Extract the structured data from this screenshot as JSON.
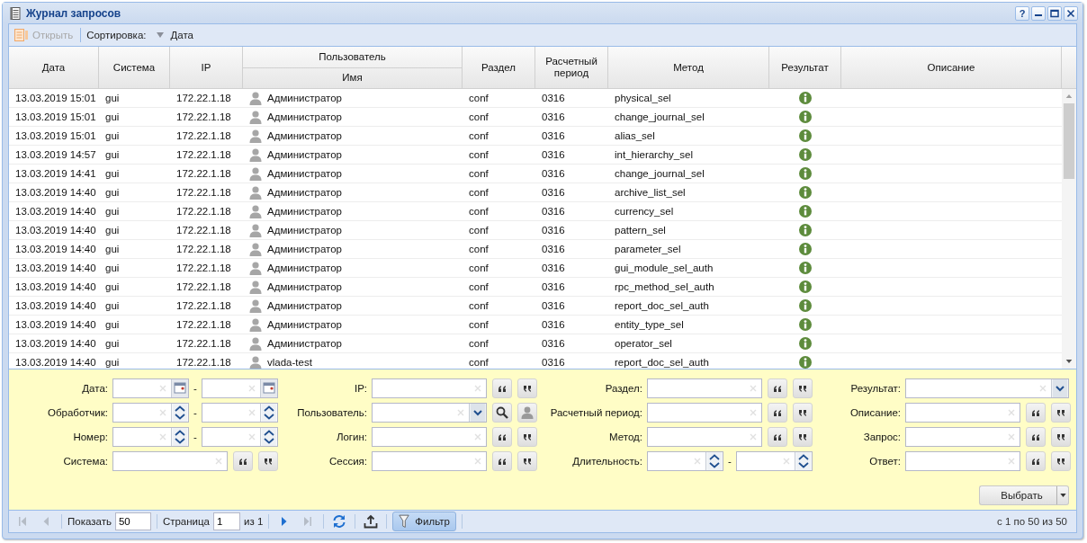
{
  "window": {
    "title": "Журнал запросов",
    "help": "?"
  },
  "toolbar": {
    "open": {
      "label": "Открыть",
      "disabled": true
    },
    "sort_label": "Сортировка:",
    "sort_field": "Дата"
  },
  "table": {
    "columns": [
      {
        "label": "Дата"
      },
      {
        "label": "Система"
      },
      {
        "label": "IP"
      },
      {
        "label": "Пользователь",
        "sub": "Имя"
      },
      {
        "label": "Раздел"
      },
      {
        "label": "Расчетный период"
      },
      {
        "label": "Метод"
      },
      {
        "label": "Результат"
      },
      {
        "label": "Описание"
      }
    ],
    "rows": [
      {
        "date": "13.03.2019 15:01",
        "system": "gui",
        "ip": "172.22.1.18",
        "user": "Администратор",
        "section": "conf",
        "period": "0316",
        "method": "physical_sel",
        "kind": "info"
      },
      {
        "date": "13.03.2019 15:01",
        "system": "gui",
        "ip": "172.22.1.18",
        "user": "Администратор",
        "section": "conf",
        "period": "0316",
        "method": "change_journal_sel",
        "kind": "info"
      },
      {
        "date": "13.03.2019 15:01",
        "system": "gui",
        "ip": "172.22.1.18",
        "user": "Администратор",
        "section": "conf",
        "period": "0316",
        "method": "alias_sel",
        "kind": "info"
      },
      {
        "date": "13.03.2019 14:57",
        "system": "gui",
        "ip": "172.22.1.18",
        "user": "Администратор",
        "section": "conf",
        "period": "0316",
        "method": "int_hierarchy_sel",
        "kind": "info"
      },
      {
        "date": "13.03.2019 14:41",
        "system": "gui",
        "ip": "172.22.1.18",
        "user": "Администратор",
        "section": "conf",
        "period": "0316",
        "method": "change_journal_sel",
        "kind": "info"
      },
      {
        "date": "13.03.2019 14:40",
        "system": "gui",
        "ip": "172.22.1.18",
        "user": "Администратор",
        "section": "conf",
        "period": "0316",
        "method": "archive_list_sel",
        "kind": "info"
      },
      {
        "date": "13.03.2019 14:40",
        "system": "gui",
        "ip": "172.22.1.18",
        "user": "Администратор",
        "section": "conf",
        "period": "0316",
        "method": "currency_sel",
        "kind": "info"
      },
      {
        "date": "13.03.2019 14:40",
        "system": "gui",
        "ip": "172.22.1.18",
        "user": "Администратор",
        "section": "conf",
        "period": "0316",
        "method": "pattern_sel",
        "kind": "info"
      },
      {
        "date": "13.03.2019 14:40",
        "system": "gui",
        "ip": "172.22.1.18",
        "user": "Администратор",
        "section": "conf",
        "period": "0316",
        "method": "parameter_sel",
        "kind": "info"
      },
      {
        "date": "13.03.2019 14:40",
        "system": "gui",
        "ip": "172.22.1.18",
        "user": "Администратор",
        "section": "conf",
        "period": "0316",
        "method": "gui_module_sel_auth",
        "kind": "info"
      },
      {
        "date": "13.03.2019 14:40",
        "system": "gui",
        "ip": "172.22.1.18",
        "user": "Администратор",
        "section": "conf",
        "period": "0316",
        "method": "rpc_method_sel_auth",
        "kind": "info"
      },
      {
        "date": "13.03.2019 14:40",
        "system": "gui",
        "ip": "172.22.1.18",
        "user": "Администратор",
        "section": "conf",
        "period": "0316",
        "method": "report_doc_sel_auth",
        "kind": "info"
      },
      {
        "date": "13.03.2019 14:40",
        "system": "gui",
        "ip": "172.22.1.18",
        "user": "Администратор",
        "section": "conf",
        "period": "0316",
        "method": "entity_type_sel",
        "kind": "info"
      },
      {
        "date": "13.03.2019 14:40",
        "system": "gui",
        "ip": "172.22.1.18",
        "user": "Администратор",
        "section": "conf",
        "period": "0316",
        "method": "operator_sel",
        "kind": "info"
      },
      {
        "date": "13.03.2019 14:40",
        "system": "gui",
        "ip": "172.22.1.18",
        "user": "vlada-test",
        "section": "conf",
        "period": "0316",
        "method": "report_doc_sel_auth",
        "kind": "info"
      }
    ]
  },
  "filters": [
    [
      {
        "label": "Дата:",
        "kind": "date_range",
        "separator": "-"
      },
      {
        "label": "Обработчик:",
        "kind": "spin_range",
        "separator": "-"
      },
      {
        "label": "Номер:",
        "kind": "spin_range",
        "separator": "-"
      },
      {
        "label": "Система:",
        "kind": "text"
      }
    ],
    [
      {
        "label": "IP:",
        "kind": "text"
      },
      {
        "label": "Пользователь:",
        "kind": "user_combo"
      },
      {
        "label": "Логин:",
        "kind": "text"
      },
      {
        "label": "Сессия:",
        "kind": "text"
      }
    ],
    [
      {
        "label": "Раздел:",
        "kind": "text"
      },
      {
        "label": "Расчетный период:",
        "kind": "text"
      },
      {
        "label": "Метод:",
        "kind": "text"
      },
      {
        "label": "Длительность:",
        "kind": "spin_range",
        "separator": "-"
      }
    ],
    [
      {
        "label": "Результат:",
        "kind": "combo"
      },
      {
        "label": "Описание:",
        "kind": "text"
      },
      {
        "label": "Запрос:",
        "kind": "text"
      },
      {
        "label": "Ответ:",
        "kind": "text"
      }
    ]
  ],
  "select_button": "Выбрать",
  "paging": {
    "nav": [
      {
        "kind": "first",
        "disabled": true
      },
      {
        "kind": "prev",
        "disabled": true
      },
      {
        "kind": "next",
        "disabled": false
      },
      {
        "kind": "last",
        "disabled": true
      }
    ],
    "show_label": "Показать",
    "page_size": "50",
    "page_label": "Страница",
    "page": "1",
    "page_total": "из 1",
    "filter": {
      "label": "Фильтр",
      "selected": true
    },
    "summary": "с 1 по 50 из 50"
  }
}
